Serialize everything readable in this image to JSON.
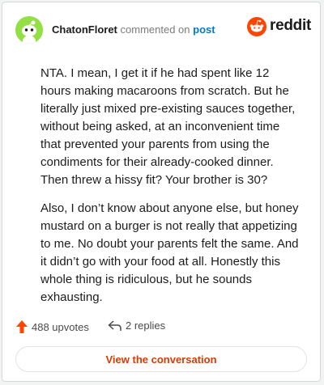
{
  "header": {
    "username": "ChatonFloret",
    "action_text": "commented on",
    "post_link": "post",
    "brand": "reddit"
  },
  "comment": {
    "paragraphs": [
      "NTA. I mean, I get it if he had spent like 12 hours making macaroons from scratch. But he literally just mixed pre-existing sauces together, without being asked, at an inconvenient time that prevented your parents from using the condiments for their already-cooked dinner. Then threw a hissy fit? Your brother is 30?",
      "Also, I don’t know about anyone else, but honey mustard on a burger is not really that appetizing to me. No doubt your parents felt the same. And it didn’t go with your food at all. Honestly this whole thing is ridiculous, but he sounds exhausting."
    ]
  },
  "footer": {
    "upvotes": "488 upvotes",
    "replies": "2 replies",
    "cta": "View the conversation"
  },
  "colors": {
    "avatar_bg": "#94e044",
    "brand_orange": "#ff4500",
    "link_blue": "#0079d3",
    "cta_text": "#d93a00"
  }
}
